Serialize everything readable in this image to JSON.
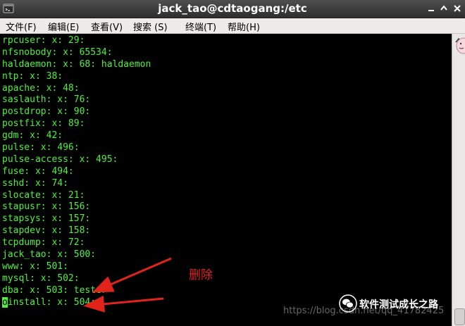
{
  "window": {
    "title": "jack_tao@cdtaogang:/etc"
  },
  "menu": {
    "items": [
      {
        "label": "文件(F)"
      },
      {
        "label": "编辑(E)"
      },
      {
        "label": "查看(V)"
      },
      {
        "label": "搜索 (S)"
      },
      {
        "label": "终端(T)"
      },
      {
        "label": "帮助(H)"
      }
    ]
  },
  "terminal": {
    "lines": [
      "rpcuser: x: 29:",
      "nfsnobody: x: 65534:",
      "haldaemon: x: 68: haldaemon",
      "ntp: x: 38:",
      "apache: x: 48:",
      "saslauth: x: 76:",
      "postdrop: x: 90:",
      "postfix: x: 89:",
      "gdm: x: 42:",
      "pulse: x: 496:",
      "pulse-access: x: 495:",
      "fuse: x: 494:",
      "sshd: x: 74:",
      "slocate: x: 21:",
      "stapusr: x: 156:",
      "stapsys: x: 157:",
      "stapdev: x: 158:",
      "tcpdump: x: 72:",
      "jack_tao: x: 500:",
      "www: x: 501:",
      "mysql: x: 502:",
      "dba: x: 503: tester"
    ],
    "cursor_line": {
      "cursor_char": "o",
      "rest": "install: x: 504:"
    },
    "text_color": "#4ff13a",
    "background_color": "#000000"
  },
  "annotation": {
    "label": "删除",
    "color": "#e0241c"
  },
  "watermark": {
    "brand": "软件测试成长之路",
    "url": "https://blog.csdn.net/qq_41782425"
  }
}
